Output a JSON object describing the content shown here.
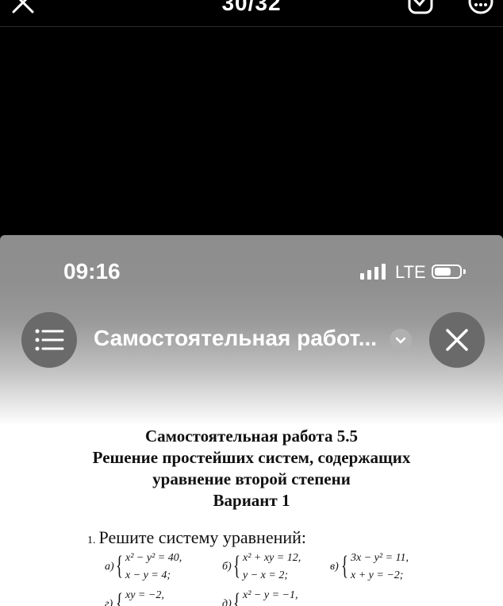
{
  "viewer": {
    "counter": "30/32",
    "icons": [
      "close-icon",
      "save-icon",
      "more-icon"
    ]
  },
  "status_bar": {
    "time": "09:16",
    "network": "LTE"
  },
  "doc_header": {
    "title": "Самостоятельная работ...",
    "icons": [
      "list-icon",
      "chevron-down-icon",
      "close-icon"
    ]
  },
  "document": {
    "heading_lines": [
      "Самостоятельная работа 5.5",
      "Решение простейших систем, содержащих",
      "уравнение второй степени",
      "Вариант 1"
    ],
    "task_number": "1.",
    "task_text": "Решите систему уравнений:",
    "systems": [
      {
        "label": "а)",
        "eq1": "x² − y² = 40,",
        "eq2": "x − y = 4;"
      },
      {
        "label": "б)",
        "eq1": "x² + xy = 12,",
        "eq2": "y − x = 2;"
      },
      {
        "label": "в)",
        "eq1": "3x − y² = 11,",
        "eq2": "x + y = −2;"
      },
      {
        "label": "г)",
        "eq1": "xy = −2,",
        "eq2": ""
      },
      {
        "label": "д)",
        "eq1": "x² − y = −1,",
        "eq2": ""
      }
    ]
  },
  "colors": {
    "background": "#000000",
    "header_gray": "#8e8e8e",
    "button_gray": "#6a6a6a",
    "text": "#111111"
  }
}
